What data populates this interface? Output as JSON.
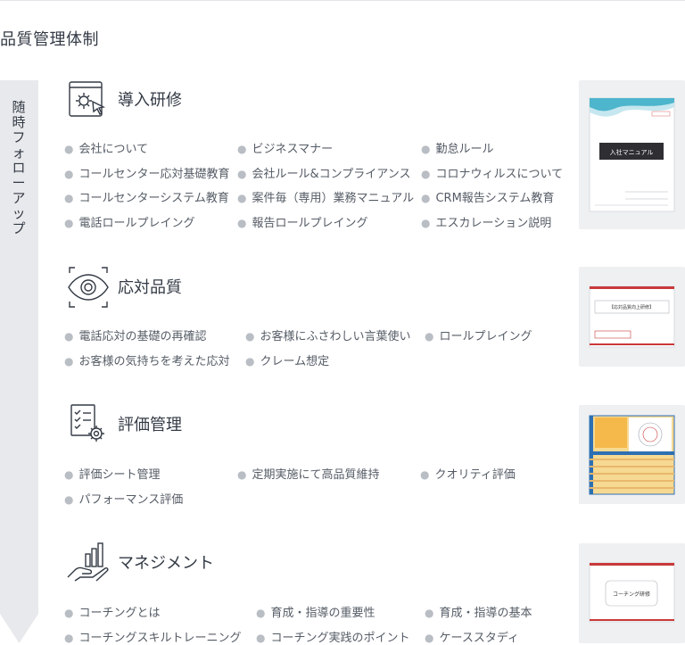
{
  "page": {
    "title": "品質管理体制"
  },
  "follow_bar": {
    "label": "随時フォローアップ"
  },
  "sections": [
    {
      "title": "導入研修",
      "icon": "monitor-gear-cursor-icon",
      "items": [
        "会社について",
        "ビジネスマナー",
        "勤怠ルール",
        "コールセンター応対基礎教育",
        "会社ルール&コンプライアンス",
        "コロナウィルスについて",
        "コールセンターシステム教育",
        "案件毎（専用）業務マニュアル",
        "CRM報告システム教育",
        "電話ロールプレイング",
        "報告ロールプレイング",
        "エスカレーション説明"
      ],
      "thumb": {
        "title": "入社マニュアル"
      }
    },
    {
      "title": "応対品質",
      "icon": "eye-icon",
      "items": [
        "電話応対の基礎の再確認",
        "お客様にふさわしい言葉使い",
        "ロールプレイング",
        "お客様の気持ちを考えた応対",
        "クレーム想定"
      ],
      "thumb": {
        "title": "【応対品質向上研修】"
      }
    },
    {
      "title": "評価管理",
      "icon": "checklist-gear-icon",
      "items": [
        "評価シート管理",
        "定期実施にて高品質維持",
        "クオリティ評価",
        "パフォーマンス評価"
      ],
      "thumb": {}
    },
    {
      "title": "マネジメント",
      "icon": "hand-growth-chart-icon",
      "items": [
        "コーチングとは",
        "育成・指導の重要性",
        "育成・指導の基本",
        "コーチングスキルトレーニング",
        "コーチング実践のポイント",
        "ケーススタディ"
      ],
      "thumb": {
        "title": "コーチング研修"
      }
    }
  ],
  "colors": {
    "accent_red": "#c9393b",
    "bar_gray": "#e8e9ec",
    "text": "#333a45",
    "thumb_bg": "#eef0f2"
  }
}
